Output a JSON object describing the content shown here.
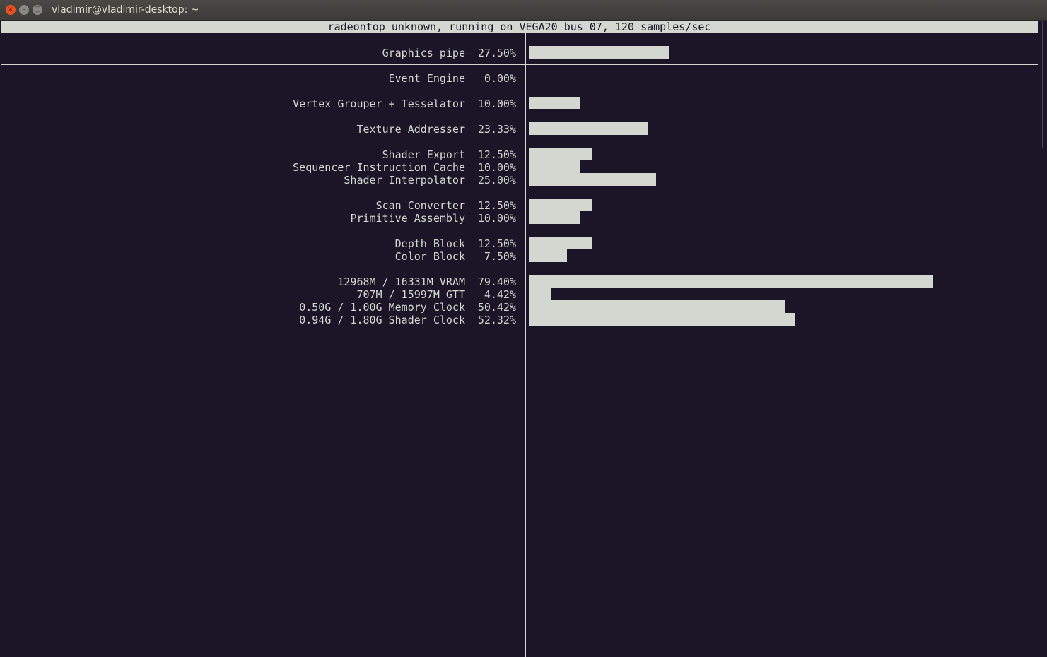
{
  "window": {
    "title": "vladimir@vladimir-desktop: ~",
    "buttons": {
      "close": "×",
      "minimize": "–",
      "maximize": "□"
    }
  },
  "header": {
    "text": "radeontop unknown, running on VEGA20 bus 07, 120 samples/sec"
  },
  "metrics": [
    {
      "label": "Graphics pipe",
      "percent": "27.50%",
      "value": 27.5
    },
    {
      "label": "Event Engine",
      "percent": "0.00%",
      "value": 0
    },
    {
      "label": "Vertex Grouper + Tesselator",
      "percent": "10.00%",
      "value": 10
    },
    {
      "label": "Texture Addresser",
      "percent": "23.33%",
      "value": 23.33
    },
    {
      "label": "Shader Export",
      "percent": "12.50%",
      "value": 12.5
    },
    {
      "label": "Sequencer Instruction Cache",
      "percent": "10.00%",
      "value": 10
    },
    {
      "label": "Shader Interpolator",
      "percent": "25.00%",
      "value": 25
    },
    {
      "label": "Scan Converter",
      "percent": "12.50%",
      "value": 12.5
    },
    {
      "label": "Primitive Assembly",
      "percent": "10.00%",
      "value": 10
    },
    {
      "label": "Depth Block",
      "percent": "12.50%",
      "value": 12.5
    },
    {
      "label": "Color Block",
      "percent": "7.50%",
      "value": 7.5
    },
    {
      "label": "12968M / 16331M VRAM",
      "percent": "79.40%",
      "value": 79.4
    },
    {
      "label": "707M / 15997M GTT",
      "percent": "4.42%",
      "value": 4.42
    },
    {
      "label": "0.50G / 1.00G Memory Clock",
      "percent": "50.42%",
      "value": 50.42
    },
    {
      "label": "0.94G / 1.80G Shader Clock",
      "percent": "52.32%",
      "value": 52.32
    }
  ]
}
